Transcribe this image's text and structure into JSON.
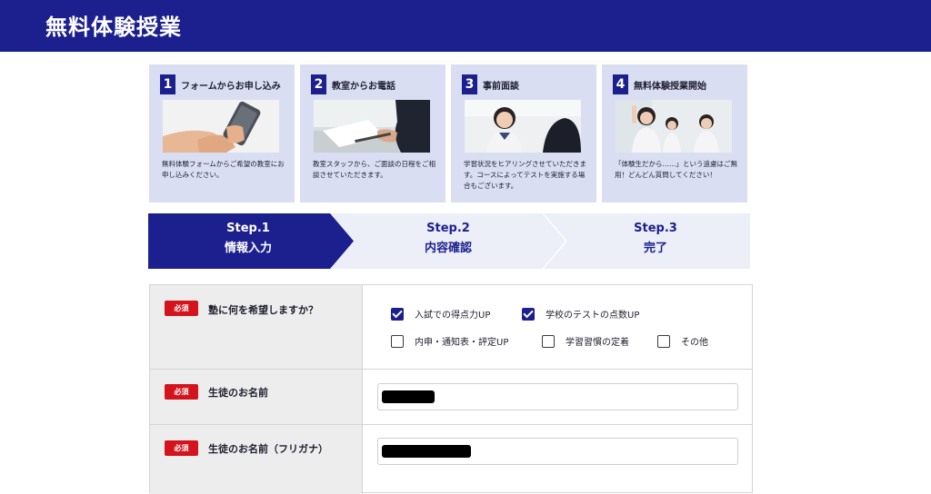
{
  "header": {
    "title": "無料体験授業"
  },
  "flow": [
    {
      "num": "1",
      "title": "フォームからお申し込み",
      "text": "無料体験フォームからご希望の教室にお申し込みください。"
    },
    {
      "num": "2",
      "title": "教室からお電話",
      "text": "教室スタッフから、ご面談の日程をご相談させていただきます。"
    },
    {
      "num": "3",
      "title": "事前面談",
      "text": "学習状況をヒアリングさせていただきます。コースによってテストを実施する場合もございます。"
    },
    {
      "num": "4",
      "title": "無料体験授業開始",
      "text": "「体験生だから……」という遠慮はご無用！どんどん質問してください！"
    }
  ],
  "steps": [
    {
      "label": "Step.1",
      "name": "情報入力",
      "active": true
    },
    {
      "label": "Step.2",
      "name": "内容確認",
      "active": false
    },
    {
      "label": "Step.3",
      "name": "完了",
      "active": false
    }
  ],
  "form": {
    "required_badge": "必須",
    "q1": {
      "label": "塾に何を希望しますか？",
      "options": [
        {
          "label": "入試での得点力UP",
          "checked": true
        },
        {
          "label": "学校のテストの点数UP",
          "checked": true
        },
        {
          "label": "内申・通知表・評定UP",
          "checked": false
        },
        {
          "label": "学習習慣の定着",
          "checked": false
        },
        {
          "label": "その他",
          "checked": false
        }
      ]
    },
    "q2": {
      "label": "生徒のお名前"
    },
    "q3": {
      "label": "生徒のお名前（フリガナ）"
    }
  },
  "colors": {
    "primary": "#1c1f8e",
    "card_bg": "#d9def3",
    "required": "#d4141c",
    "step_inactive": "#eceef8"
  }
}
